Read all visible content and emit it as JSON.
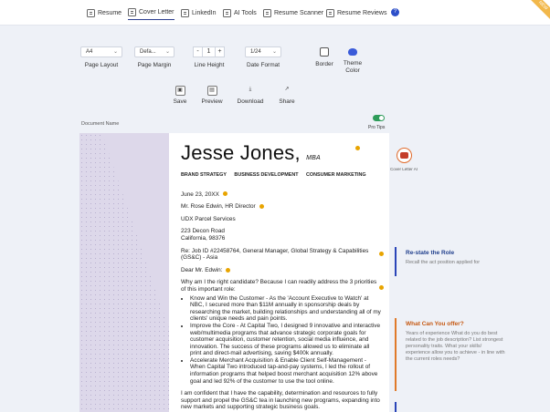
{
  "nav": {
    "items": [
      {
        "label": "Resume",
        "icon": "resume-icon"
      },
      {
        "label": "Cover Letter",
        "icon": "cover-letter-icon"
      },
      {
        "label": "LinkedIn",
        "icon": "linkedin-icon"
      },
      {
        "label": "AI Tools",
        "icon": "ai-tools-icon"
      },
      {
        "label": "Resume Scanner",
        "icon": "scanner-icon"
      },
      {
        "label": "Resume Reviews",
        "icon": "reviews-icon"
      }
    ],
    "active": "Cover Letter",
    "help_label": "?",
    "ribbon": "NEW"
  },
  "toolbar": {
    "page_layout": {
      "value": "A4",
      "label": "Page Layout"
    },
    "page_margin": {
      "value": "Defa...",
      "label": "Page Margin"
    },
    "line_height": {
      "minus": "-",
      "value": "1",
      "plus": "+",
      "label": "Line Height"
    },
    "date_format": {
      "value": "1/24",
      "label": "Date Format"
    },
    "border": {
      "label": "Border"
    },
    "theme_color": {
      "label": "Theme Color"
    },
    "actions": [
      {
        "label": "Save",
        "icon": "save-icon"
      },
      {
        "label": "Preview",
        "icon": "preview-icon"
      },
      {
        "label": "Download",
        "icon": "download-icon"
      },
      {
        "label": "Share",
        "icon": "share-icon"
      }
    ]
  },
  "document_name_label": "Document Name",
  "pro_tips_label": "Pro Tips",
  "letter": {
    "name": "Jesse Jones,",
    "credential": "MBA",
    "tags": [
      "BRAND STRATEGY",
      "BUSINESS DEVELOPMENT",
      "CONSUMER MARKETING"
    ],
    "date": "June 23, 20XX",
    "recipient": [
      "Mr. Rose Edwin, HR Director"
    ],
    "company": [
      "UDX Parcel Services"
    ],
    "address": [
      "223 Decon Road",
      "California, 98376"
    ],
    "subject": "Re: Job ID #22458764, General Manager, Global Strategy & Capabilities (GS&C) - Asia",
    "salutation": "Dear Mr. Edwin:",
    "intro": "Why am I the right candidate? Because I can readily address the 3 priorities of this important role:",
    "bullets": [
      "Know and Win the Customer - As the 'Account Executive to Watch' at NBC, I secured more than $11M annually in sponsorship deals by researching the market, building relationships and understanding all of my clients' unique needs and pain points.",
      "Improve the Core - At Capital Two, I designed 9 innovative and interactive web/multimedia programs that advance strategic corporate goals for customer acquisition, customer retention, social media influence, and innovation. The success of these programs allowed us to eliminate all print and direct-mail advertising, saving $400k annually.",
      "Accelerate Merchant Acquisition & Enable Client Self-Management - When Capital Two introduced tap-and-pay systems, I led the rollout of information programs that helped boost merchant acquisition 12% above goal and led 92% of the customer to use the tool online."
    ],
    "closing": "I am confident that I have the capability, determination and resources to fully support and propel the GS&C tea in launching new programs, expanding into new markets and supporting strategic business goals."
  },
  "side_panel": {
    "cover_letter_ai": "Cover Letter AI",
    "tips": [
      {
        "title": "Re-state the Role",
        "body": "Recall the act position applied for",
        "color": "#2a45b8"
      },
      {
        "title": "What Can You offer?",
        "body": "Years of experience What do you do best related to the job description? List strongest personality traits. What your skills/ experience allow you to achieve - in line with the current roles needs?",
        "color": "#e07a2a"
      }
    ]
  }
}
